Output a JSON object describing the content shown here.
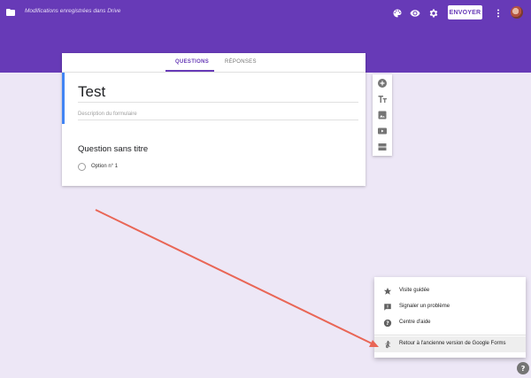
{
  "header": {
    "save_status": "Modifications enregistrées dans Drive",
    "send_label": "ENVOYER",
    "icons": [
      "folder-icon",
      "palette-icon",
      "eye-icon",
      "gear-icon",
      "more-vert-icon"
    ]
  },
  "tabs": [
    {
      "label": "QUESTIONS",
      "active": true
    },
    {
      "label": "RÉPONSES",
      "active": false
    }
  ],
  "form": {
    "title": "Test",
    "description_placeholder": "Description du formulaire",
    "question": {
      "title": "Question sans titre",
      "options": [
        "Option n° 1"
      ]
    }
  },
  "toolbar": {
    "tools": [
      "add-question-icon",
      "title-text-icon",
      "image-icon",
      "video-icon",
      "section-icon"
    ]
  },
  "help_menu": {
    "items": [
      {
        "label": "Visite guidée",
        "icon": "star-icon"
      },
      {
        "label": "Signaler un problème",
        "icon": "feedback-icon"
      },
      {
        "label": "Centre d'aide",
        "icon": "help-icon"
      },
      {
        "label": "Retour à l'ancienne version de Google Forms",
        "icon": "walk-icon"
      }
    ]
  },
  "colors": {
    "header": "#673ab7",
    "background": "#ede7f6",
    "accent": "#673ab7",
    "title_border": "#4285f4",
    "annotation_arrow": "#e96656"
  }
}
